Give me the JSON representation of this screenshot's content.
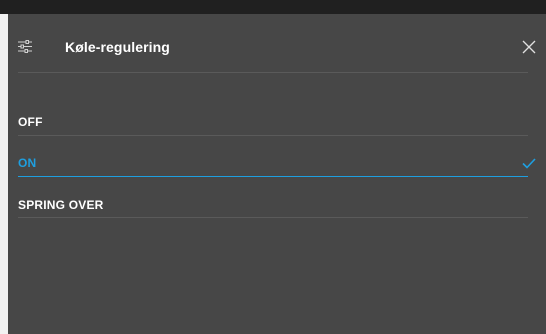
{
  "dialog": {
    "title": "Køle-regulering",
    "settings_icon": "sliders-icon",
    "close_icon": "close-icon"
  },
  "options": [
    {
      "label": "OFF",
      "selected": false
    },
    {
      "label": "ON",
      "selected": true
    },
    {
      "label": "SPRING OVER",
      "selected": false
    }
  ],
  "colors": {
    "panel_background": "#474747",
    "accent": "#1e9fe0",
    "text": "#ffffff",
    "divider": "#5a5a5a"
  },
  "check_icon": "checkmark-icon"
}
